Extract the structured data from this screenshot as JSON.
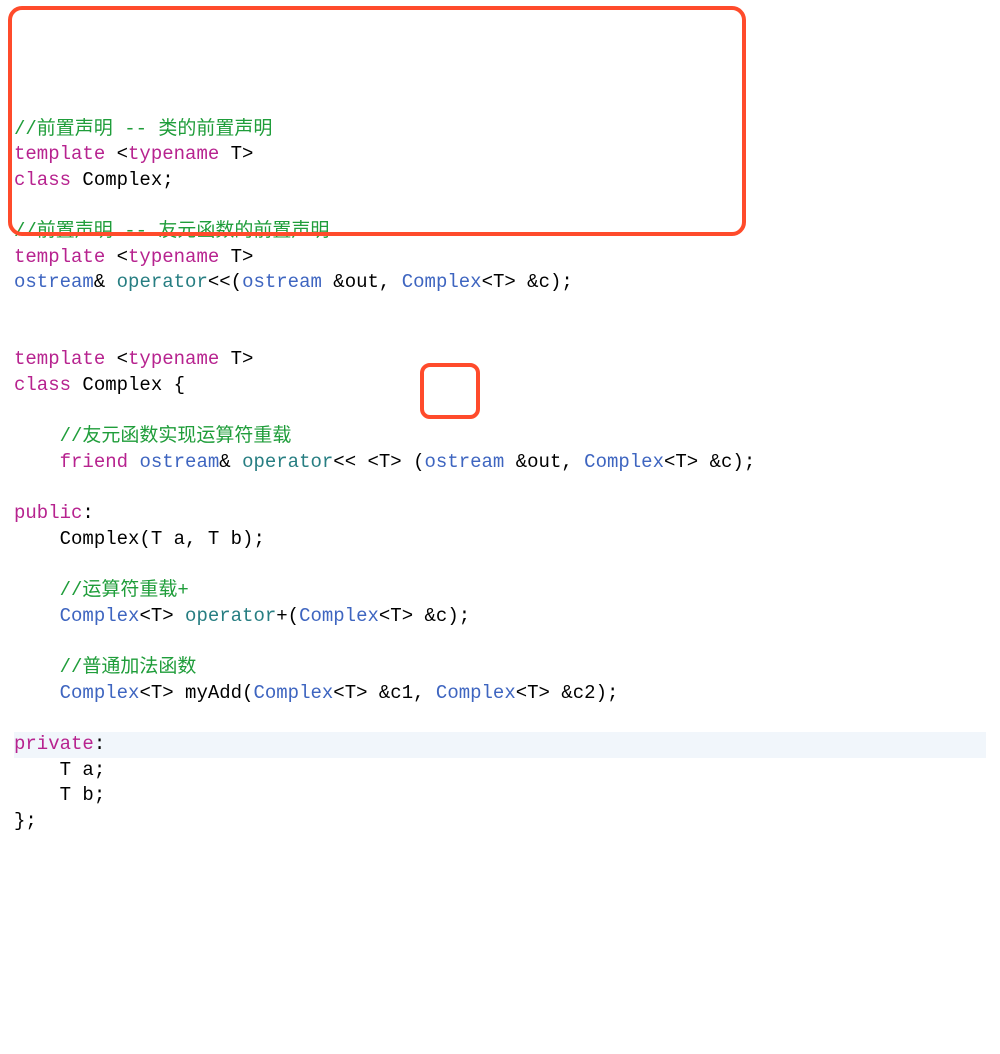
{
  "l1": {
    "c": "//前置声明 -- 类的前置声明"
  },
  "l2": {
    "k1": "template",
    "p1": " <",
    "k2": "typename",
    "p2": " T>"
  },
  "l3": {
    "k1": "class",
    "p1": " Complex;"
  },
  "l5": {
    "c": "//前置声明 -- 友元函数的前置声明"
  },
  "l6": {
    "k1": "template",
    "p1": " <",
    "k2": "typename",
    "p2": " T>"
  },
  "l7": {
    "t1": "ostream",
    "p1": "& ",
    "f": "operator",
    "p2": "<<(",
    "t2": "ostream",
    "p3": " &out, ",
    "t3": "Complex",
    "p4": "<T> &c);"
  },
  "l9": {
    "k1": "template",
    "p1": " <",
    "k2": "typename",
    "p2": " T>"
  },
  "l10": {
    "k1": "class",
    "p1": " Complex {"
  },
  "l12": {
    "c": "    //友元函数实现运算符重载"
  },
  "l13": {
    "pad": "    ",
    "k1": "friend",
    "p1": " ",
    "t1": "ostream",
    "p2": "& ",
    "f": "operator",
    "p3": "<< <T> (",
    "t2": "ostream",
    "p4": " &out, ",
    "t3": "Complex",
    "p5": "<T> &c);"
  },
  "l15": {
    "k1": "public",
    "p1": ":"
  },
  "l16": {
    "pad": "    Complex(T a, T b);"
  },
  "l18": {
    "c": "    //运算符重载+"
  },
  "l19": {
    "pad": "    ",
    "t1": "Complex",
    "p1": "<T> ",
    "f": "operator",
    "p2": "+(",
    "t2": "Complex",
    "p3": "<T> &c);"
  },
  "l21": {
    "c": "    //普通加法函数"
  },
  "l22": {
    "pad": "    ",
    "t1": "Complex",
    "p1": "<T> myAdd(",
    "t2": "Complex",
    "p2": "<T> &c1, ",
    "t3": "Complex",
    "p3": "<T> &c2);"
  },
  "l24": {
    "k1": "private",
    "p1": ":"
  },
  "l25": {
    "pad": "    T a;"
  },
  "l26": {
    "pad": "    T b;"
  },
  "l27": {
    "p": "};"
  }
}
